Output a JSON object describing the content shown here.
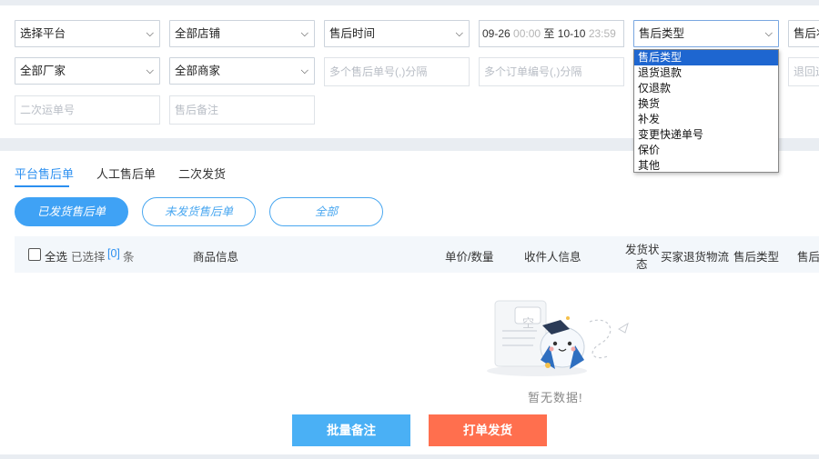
{
  "filters": {
    "row1": {
      "platform": "选择平台",
      "store": "全部店铺",
      "time_type": "售后时间",
      "date_start": "09-26",
      "time_start": "00:00",
      "date_sep": "至",
      "date_end": "10-10",
      "time_end": "23:59",
      "aftersale_type": "售后类型",
      "cut_label": "售后状"
    },
    "row2": {
      "manufacturer": "全部厂家",
      "merchant": "全部商家",
      "aftersale_no_placeholder": "多个售后单号(,)分隔",
      "order_no_placeholder": "多个订单编号(,)分隔",
      "cut_placeholder": "退回运"
    },
    "row3": {
      "second_tracking_placeholder": "二次运单号",
      "aftersale_note_placeholder": "售后备注"
    }
  },
  "dropdown": {
    "options": [
      "售后类型",
      "退货退款",
      "仅退款",
      "换货",
      "补发",
      "变更快递单号",
      "保价",
      "其他"
    ],
    "selected": "售后类型"
  },
  "tabs": [
    {
      "label": "平台售后单",
      "active": true
    },
    {
      "label": "人工售后单",
      "active": false
    },
    {
      "label": "二次发货",
      "active": false
    }
  ],
  "pills": [
    {
      "label": "已发货售后单",
      "active": true
    },
    {
      "label": "未发货售后单",
      "active": false
    },
    {
      "label": "全部",
      "active": false
    }
  ],
  "table": {
    "select_all": "全选",
    "selected_prefix": "已选择",
    "selected_count": "[0]",
    "selected_suffix": "条",
    "headers": {
      "product": "商品信息",
      "price_qty": "单价/数量",
      "receiver": "收件人信息",
      "ship_status_1": "发货状",
      "ship_status_2": "态",
      "buyer_return": "买家退货物流",
      "aftersale_type": "售后类型",
      "cut": "售后"
    }
  },
  "empty": {
    "text": "暂无数据!",
    "illustration_label": "空"
  },
  "footer": {
    "batch_note": "批量备注",
    "print_ship": "打单发货"
  },
  "colors": {
    "accent": "#2b8ff0",
    "pill_active": "#3fa2f5",
    "button_blue": "#4ab0f5",
    "button_orange": "#ff6f4e",
    "dropdown_highlight": "#1e66d0"
  }
}
